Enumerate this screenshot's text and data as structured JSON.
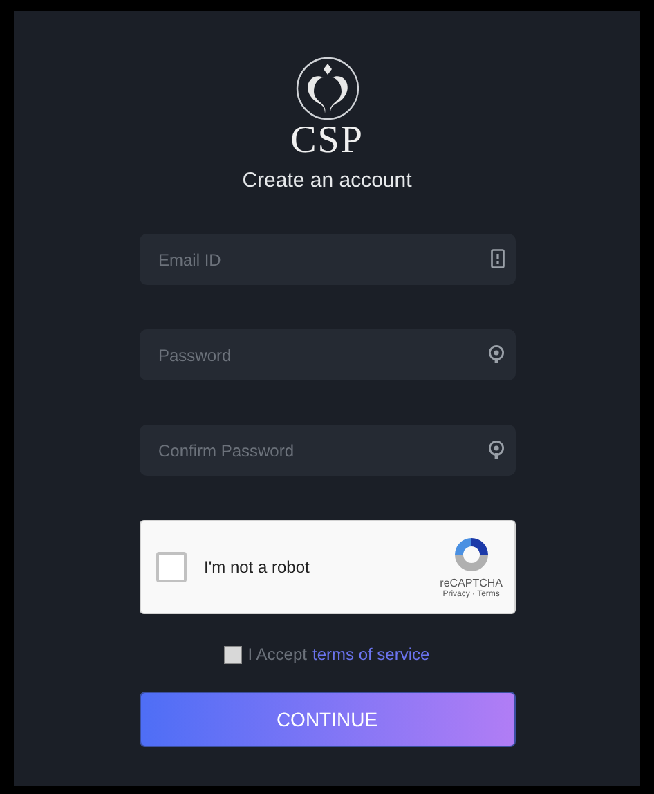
{
  "logo": {
    "text": "CSP"
  },
  "heading": "Create an account",
  "fields": [
    {
      "placeholder": "Email ID",
      "kind": "email"
    },
    {
      "placeholder": "Password",
      "kind": "password"
    },
    {
      "placeholder": "Confirm Password",
      "kind": "password"
    }
  ],
  "captcha": {
    "label": "I'm not a robot",
    "checked": false,
    "brand": "reCAPTCHA",
    "links": "Privacy · Terms"
  },
  "terms": {
    "checked": false,
    "text": "I Accept",
    "link": "terms of service"
  },
  "button": "CONTINUE"
}
